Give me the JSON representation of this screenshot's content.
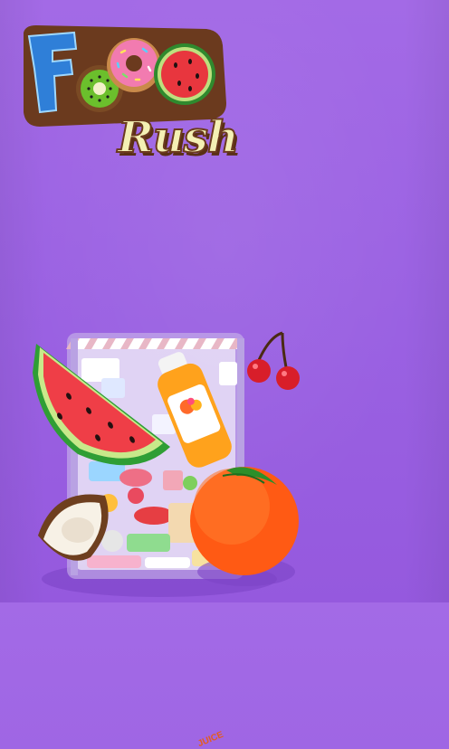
{
  "game": {
    "title_first": "F",
    "title_second": "Rush",
    "juice_label": "JUICE"
  },
  "colors": {
    "background": "#9d64e4",
    "logo_cream": "#f4f0b4",
    "logo_brown": "#6b3a1e",
    "box_stripe": "#e8b7c6"
  },
  "items": [
    "watermelon-slice",
    "juice-bottle",
    "cherries",
    "orange",
    "coconut",
    "sorting-box"
  ]
}
